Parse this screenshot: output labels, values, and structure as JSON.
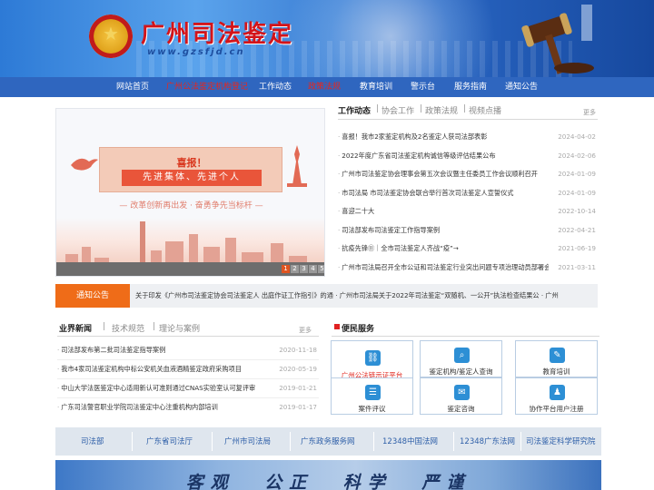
{
  "header": {
    "site_title": "广州司法鉴定",
    "site_url": "www.gzsfjd.cn"
  },
  "nav": [
    {
      "label": "网站首页",
      "highlight": false
    },
    {
      "label": "广州公法鉴定机构登记",
      "highlight": true
    },
    {
      "label": "工作动态",
      "highlight": false
    },
    {
      "label": "政策法规",
      "highlight": true
    },
    {
      "label": "教育培训",
      "highlight": false
    },
    {
      "label": "警示台",
      "highlight": false
    },
    {
      "label": "服务指南",
      "highlight": false
    },
    {
      "label": "通知公告",
      "highlight": false
    }
  ],
  "banner": {
    "title": "喜报！",
    "subtitle": "先进集体、先进个人",
    "slogan": "— 改革创新再出发 · 奋勇争先当标杆 —",
    "pager": [
      "1",
      "2",
      "3",
      "4",
      "5"
    ],
    "active_page": 0
  },
  "news_tabs": {
    "tabs": [
      "工作动态",
      "协会工作",
      "政策法规",
      "视频点播"
    ],
    "more": "更多"
  },
  "news": [
    {
      "title": "喜报！我市2家鉴定机构及2名鉴定人获司法部表彰",
      "date": "2024-04-02"
    },
    {
      "title": "2022年度广东省司法鉴定机构诚信等级评估结果公布",
      "date": "2024-02-06"
    },
    {
      "title": "广州市司法鉴定协会理事会第五次会议暨主任委员工作会议顺利召开",
      "date": "2024-01-09"
    },
    {
      "title": "市司法局 市司法鉴定协会联合举行首次司法鉴定人宣誓仪式",
      "date": "2024-01-09"
    },
    {
      "title": "喜迎二十大",
      "date": "2022-10-14"
    },
    {
      "title": "司法部发布司法鉴定工作指导案例",
      "date": "2022-04-21"
    },
    {
      "title": "抗疫先锋⑪｜全市司法鉴定人齐战“疫”→",
      "date": "2021-06-19"
    },
    {
      "title": "广州市司法局召开全市公证和司法鉴定行业突出问题专项治理动员部署会议",
      "date": "2021-03-11"
    }
  ],
  "notice": {
    "label": "通知公告",
    "text": "关于印发《广州市司法鉴定协会司法鉴定人 出庭作证工作指引》的通 · 广州市司法局关于2022年司法鉴定“双随机、一公开”执法检查结果公 · 广州"
  },
  "business_tabs": {
    "tabs": [
      "业界新闻",
      "技术规范",
      "理论与案例"
    ],
    "more": "更多"
  },
  "business_news": [
    {
      "title": "司法部发布第二批司法鉴定指导案例",
      "date": "2020-11-18"
    },
    {
      "title": "我市4家司法鉴定机构中标公安机关血液酒精鉴定政府采购项目",
      "date": "2020-05-19"
    },
    {
      "title": "中山大学法医鉴定中心适用新认可准则通过CNAS实验室认可复评审",
      "date": "2019-01-21"
    },
    {
      "title": "广东司法警官职业学院司法鉴定中心注重机构内部培训",
      "date": "2019-01-17"
    }
  ],
  "services": {
    "title": "便民服务",
    "items": [
      {
        "label": "广州公法链示证平台",
        "icon": "chain-icon",
        "highlight": true
      },
      {
        "label": "鉴定机构/鉴定人查询",
        "icon": "search-icon",
        "highlight": false
      },
      {
        "label": "教育培训",
        "icon": "training-icon",
        "highlight": false
      },
      {
        "label": "案件评议",
        "icon": "review-icon",
        "highlight": false
      },
      {
        "label": "鉴定咨询",
        "icon": "consult-icon",
        "highlight": false
      },
      {
        "label": "协作平台用户注册",
        "icon": "register-icon",
        "highlight": false
      }
    ]
  },
  "links": [
    "司法部",
    "广东省司法厅",
    "广州市司法局",
    "广东政务服务网",
    "12348中国法网",
    "12348广东法网",
    "司法鉴定科学研究院"
  ],
  "footer": {
    "motto": "客观 公正 科学 严谨"
  },
  "colors": {
    "nav_bg": "#2f66bf",
    "accent_orange": "#ef6c18",
    "highlight_red": "#e8261c",
    "service_icon": "#2d8fd5"
  }
}
